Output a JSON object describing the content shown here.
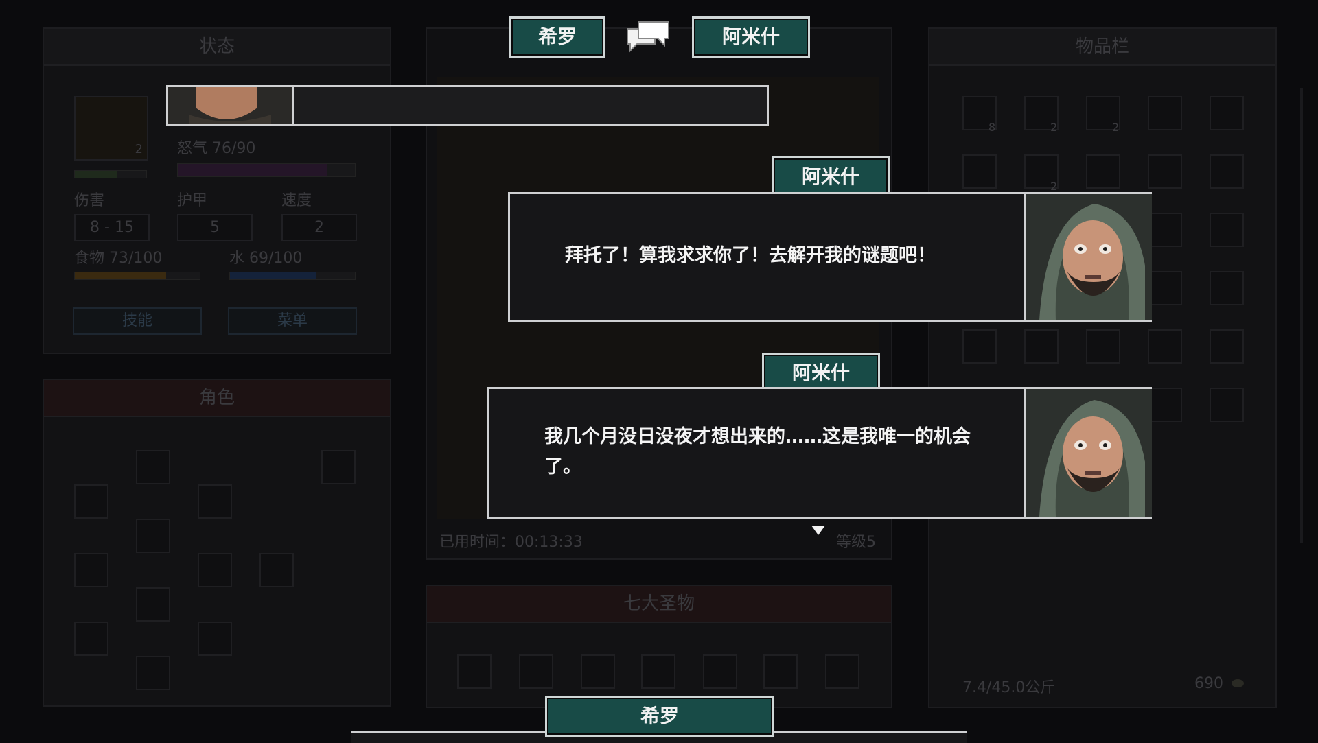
{
  "status_panel": {
    "title": "状态",
    "level_badge": "2",
    "rage_label": "怒气 76/90",
    "rage_fraction": 0.84,
    "stats": [
      {
        "label": "伤害",
        "value": "8 - 15"
      },
      {
        "label": "护甲",
        "value": "5"
      },
      {
        "label": "速度",
        "value": "2"
      }
    ],
    "food_label": "食物 73/100",
    "food_fraction": 0.73,
    "water_label": "水 69/100",
    "water_fraction": 0.69,
    "skills_button": "技能",
    "menu_button": "菜单"
  },
  "character_panel": {
    "title": "角色"
  },
  "map_panel": {
    "time_label": "已用时间：00:13:33",
    "level_label": "等级5"
  },
  "relics_panel": {
    "title": "七大圣物"
  },
  "inventory_panel": {
    "title": "物品栏",
    "counts": [
      "8",
      "2",
      "2",
      "2"
    ],
    "weight": "7.4/45.0公斤",
    "gold": "690"
  },
  "conversation": {
    "left_name": "希罗",
    "right_name": "阿米什",
    "dialogues": [
      {
        "speaker": "阿米什",
        "text": "拜托了！算我求求你了！去解开我的谜题吧！"
      },
      {
        "speaker": "阿米什",
        "text": "我几个月没日没夜才想出来的……这是我唯一的机会了。"
      }
    ],
    "bottom_speaker": "希罗"
  },
  "colors": {
    "nametag": "#184b47",
    "border": "#cfd0d2",
    "dialog_bg": "#161618"
  },
  "icons": [
    "speech-bubbles-icon",
    "continue-arrow-icon",
    "coin-icon"
  ]
}
